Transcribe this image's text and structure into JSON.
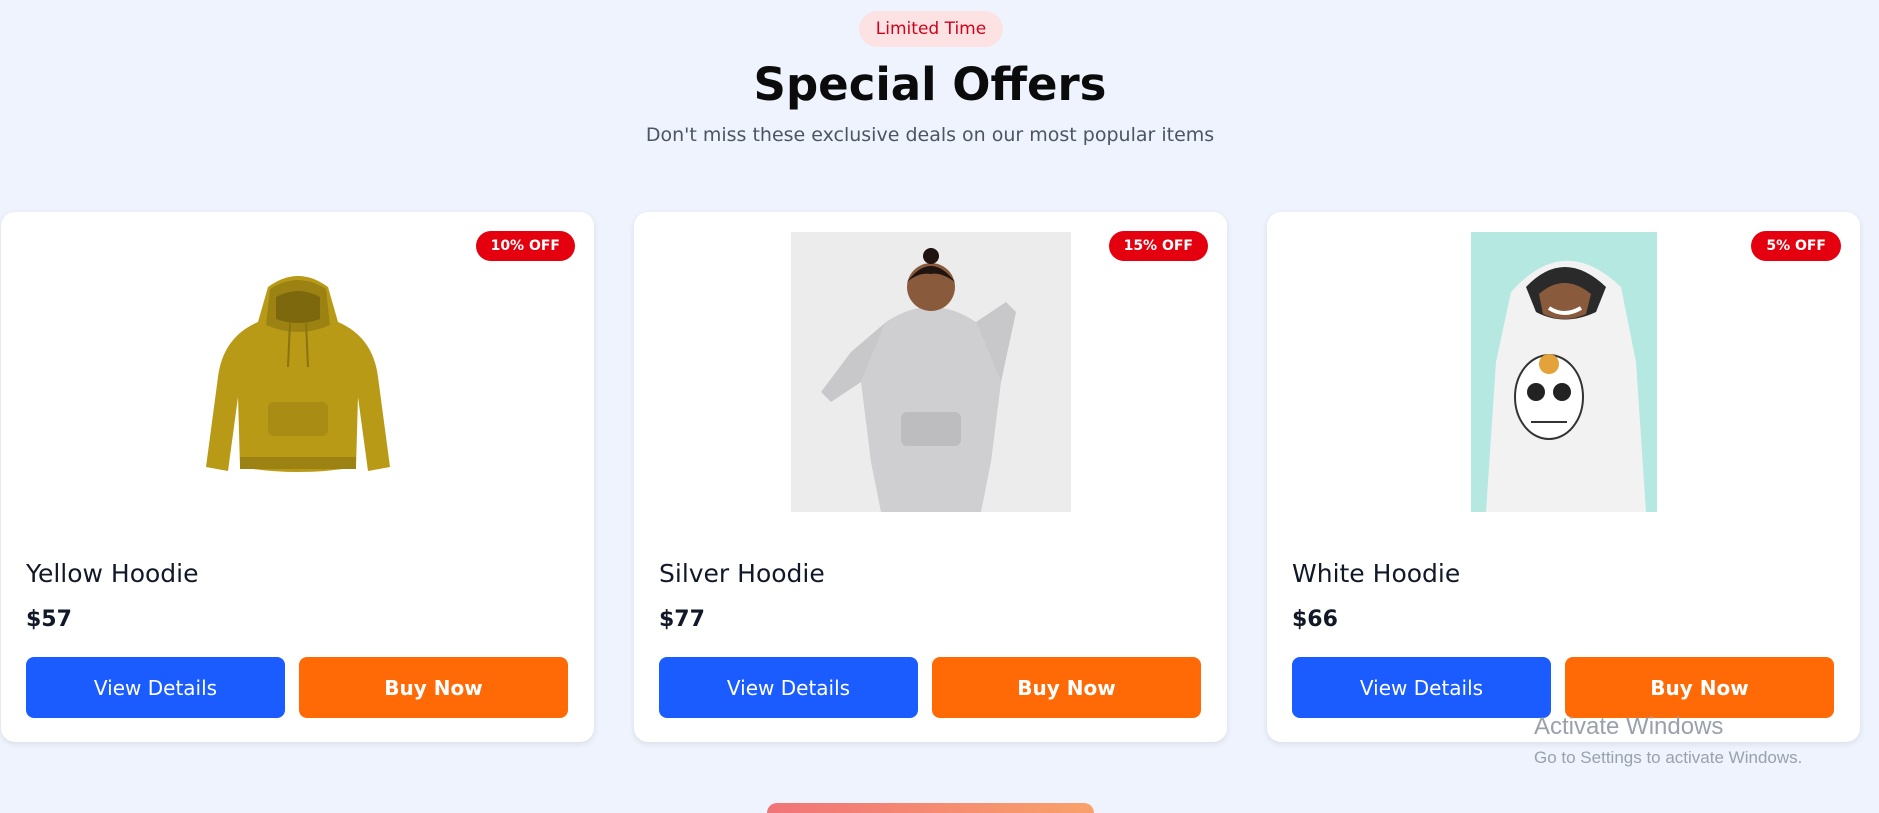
{
  "header": {
    "badge": "Limited Time",
    "title": "Special Offers",
    "subtitle": "Don't miss these exclusive deals on our most popular items"
  },
  "products": [
    {
      "name": "Yellow Hoodie",
      "price": "$57",
      "discount": "10% OFF",
      "view_label": "View Details",
      "buy_label": "Buy Now"
    },
    {
      "name": "Silver Hoodie",
      "price": "$77",
      "discount": "15% OFF",
      "view_label": "View Details",
      "buy_label": "Buy Now"
    },
    {
      "name": "White Hoodie",
      "price": "$66",
      "discount": "5% OFF",
      "view_label": "View Details",
      "buy_label": "Buy Now"
    }
  ],
  "watermark": {
    "title": "Activate Windows",
    "subtitle": "Go to Settings to activate Windows."
  },
  "colors": {
    "background": "#eef3fd",
    "badge_bg": "#fde2e3",
    "badge_text": "#d0021b",
    "discount_bg": "#e4000f",
    "view_button": "#1a5cff",
    "buy_button": "#ff6a06"
  },
  "icons": [
    "yellow-hoodie-image",
    "silver-hoodie-image",
    "white-hoodie-image"
  ]
}
